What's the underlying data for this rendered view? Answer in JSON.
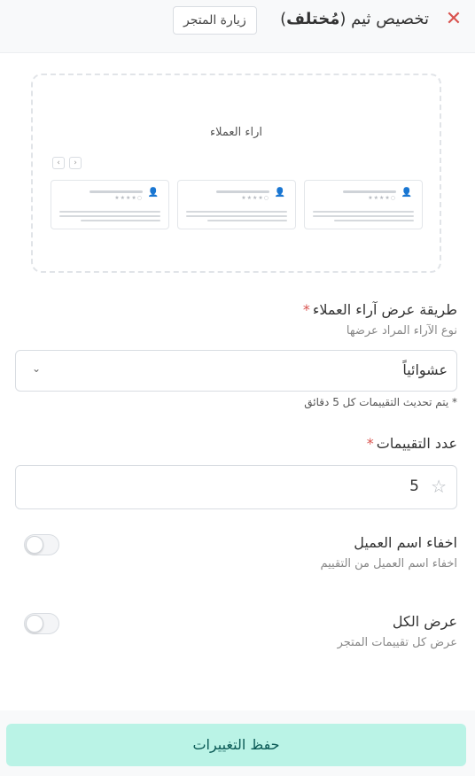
{
  "header": {
    "close_icon": "close-icon",
    "title_prefix": "تخصيص ثيم (",
    "theme_name": "مُختلف",
    "title_suffix": ")",
    "visit_store_label": "زيارة المتجر"
  },
  "preview": {
    "title": "اراء العملاء",
    "prev_arrow": "‹",
    "next_arrow": "›",
    "avatar_icon": "user-icon",
    "avatar_glyph": "👤",
    "stars_glyph": "★★★★○"
  },
  "display_method": {
    "label": "طريقة عرض آراء العملاء",
    "required_mark": "*",
    "hint": "نوع الآراء المراد عرضها",
    "selected_value": "عشوائياً",
    "note": "* يتم تحديث التقييمات كل 5 دقائق"
  },
  "ratings_count": {
    "label": "عدد التقييمات",
    "required_mark": "*",
    "value": "5",
    "star_glyph": "☆"
  },
  "hide_name": {
    "label": "اخفاء اسم العميل",
    "hint": "اخفاء اسم العميل من التقييم",
    "enabled": false
  },
  "show_all": {
    "label": "عرض الكل",
    "hint": "عرض كل تقييمات المتجر",
    "enabled": false
  },
  "footer": {
    "save_label": "حفظ التغييرات"
  },
  "colors": {
    "accent_danger": "#d9534f",
    "save_button_bg": "#baf3e6",
    "save_button_text": "#0b5a56"
  }
}
